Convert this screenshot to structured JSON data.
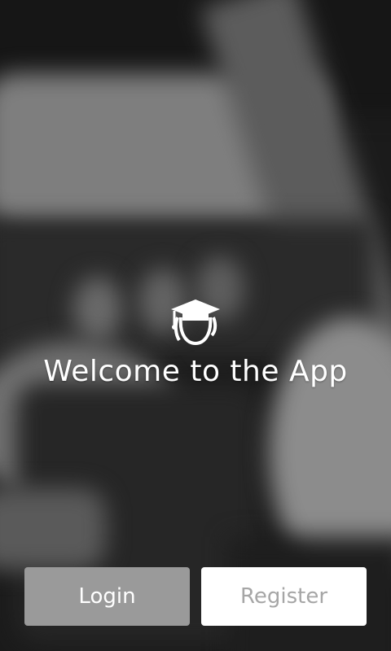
{
  "welcome": {
    "logo_icon": "graduate-cap-student-icon",
    "title": "Welcome to the App"
  },
  "actions": {
    "login_label": "Login",
    "register_label": "Register"
  },
  "colors": {
    "login_bg": "#9a9a9a",
    "register_bg": "#ffffff",
    "register_text": "#a6a6a6"
  }
}
